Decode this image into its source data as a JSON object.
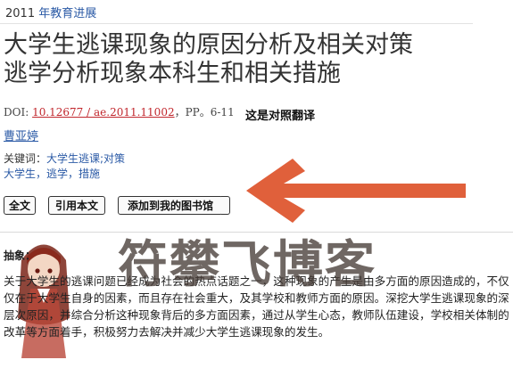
{
  "journal": {
    "year": "2011",
    "name": "年教育进展"
  },
  "title": {
    "line1": "大学生逃课现象的原因分析及相关对策",
    "line2": "逃学分析现象本科生和相关措施"
  },
  "doi": {
    "prefix": "DOI: ",
    "link": "10.12677 / ae.2011.11002",
    "pages": "，PP。6-11"
  },
  "note": "这是对照翻译",
  "author": "曹亚婷",
  "keywords": {
    "label": "关键词：",
    "line1": "大学生逃课;对策",
    "line2": "大学生，逃学，措施"
  },
  "buttons": {
    "full": "全文",
    "cite": "引用本文",
    "library": "添加到我的图书馆"
  },
  "abstract": {
    "label": "抽象：",
    "text": "关于大学生的逃课问题已经成为社会的热点话题之一，这种现象的产生是由多方面的原因造成的，不仅仅在于大学生自身的因素，而且存在社会重大，及其学校和教师方面的原因。深挖大学生逃课现象的深层次原因，并综合分析这种现象背后的多方面因素，通过从学生心态，教师队伍建设，学校相关体制的改革等方面着手，积极努力去解决并减少大学生逃课现象的发生。"
  },
  "watermark": "符攀飞博客",
  "colors": {
    "link": "#2b5aa6",
    "doi_link": "#c1272d",
    "arrow": "#e0603b"
  }
}
